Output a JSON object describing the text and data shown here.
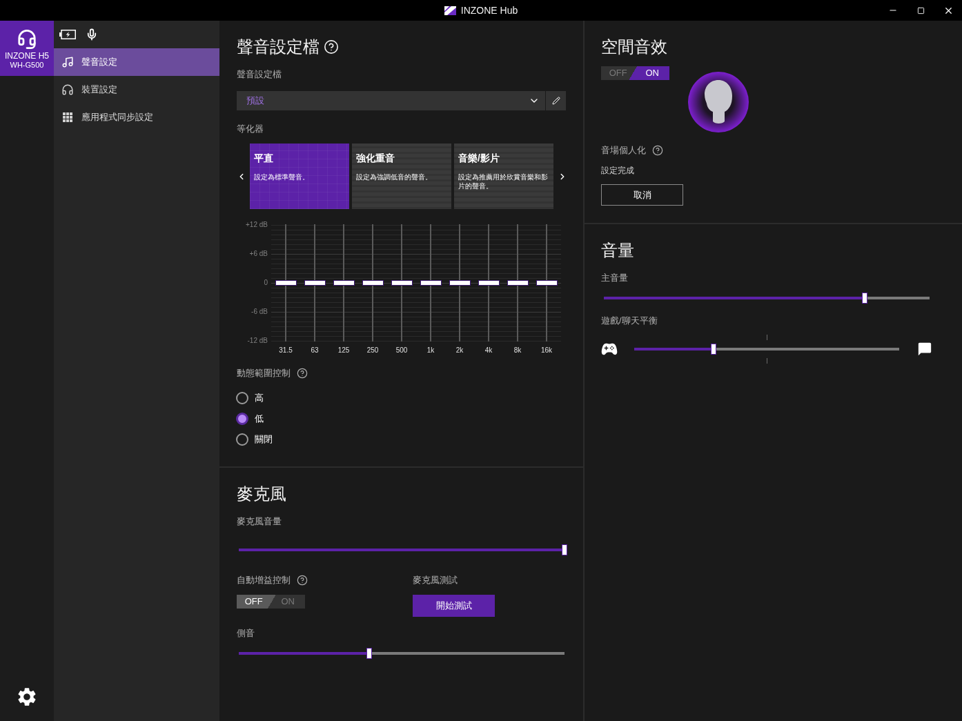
{
  "window": {
    "title": "INZONE Hub"
  },
  "device": {
    "name": "INZONE H5",
    "model": "WH-G500",
    "selected": true
  },
  "nav": {
    "items": [
      {
        "label": "聲音設定",
        "selected": true
      },
      {
        "label": "裝置設定",
        "selected": false
      },
      {
        "label": "應用程式同步設定",
        "selected": false
      }
    ]
  },
  "sound_profile": {
    "title": "聲音設定檔",
    "profile_label": "聲音設定檔",
    "profile_value": "預設",
    "equalizer_label": "等化器",
    "presets": [
      {
        "name": "平直",
        "description": "設定為標準聲音。",
        "selected": true
      },
      {
        "name": "強化重音",
        "description": "設定為強調低音的聲音。",
        "selected": false
      },
      {
        "name": "音樂/影片",
        "description": "設定為推薦用於欣賞音樂和影片的聲音。",
        "selected": false
      }
    ],
    "eq": {
      "y_labels": [
        "+12 dB",
        "+6 dB",
        "0",
        "-6 dB",
        "-12 dB"
      ],
      "bands": [
        {
          "label": "31.5",
          "level": 0.5
        },
        {
          "label": "63",
          "level": 0.5
        },
        {
          "label": "125",
          "level": 0.5
        },
        {
          "label": "250",
          "level": 0.5
        },
        {
          "label": "500",
          "level": 0.5
        },
        {
          "label": "1k",
          "level": 0.5
        },
        {
          "label": "2k",
          "level": 0.5
        },
        {
          "label": "4k",
          "level": 0.5
        },
        {
          "label": "8k",
          "level": 0.5
        },
        {
          "label": "16k",
          "level": 0.5
        }
      ]
    },
    "dynamic_range": {
      "label": "動態範圍控制",
      "options": [
        {
          "label": "高",
          "selected": false
        },
        {
          "label": "低",
          "selected": true
        },
        {
          "label": "關閉",
          "selected": false
        }
      ]
    }
  },
  "microphone": {
    "title": "麥克風",
    "volume": {
      "label": "麥克風音量",
      "level": 1
    },
    "auto_gain": {
      "label": "自動增益控制",
      "off_label": "OFF",
      "on_label": "ON",
      "on": false
    },
    "test": {
      "label": "麥克風測試",
      "button": "開始測試"
    },
    "sidetone": {
      "label": "側音",
      "level": 0.4
    }
  },
  "spatial_sound": {
    "title": "空間音效",
    "off_label": "OFF",
    "on_label": "ON",
    "on": true,
    "personalization_label": "音場個人化",
    "status": "設定完成",
    "cancel_button": "取消"
  },
  "volume": {
    "title": "音量",
    "master": {
      "label": "主音量",
      "level": 0.8
    },
    "balance": {
      "label": "遊戲/聊天平衡",
      "level": 0.3
    }
  }
}
